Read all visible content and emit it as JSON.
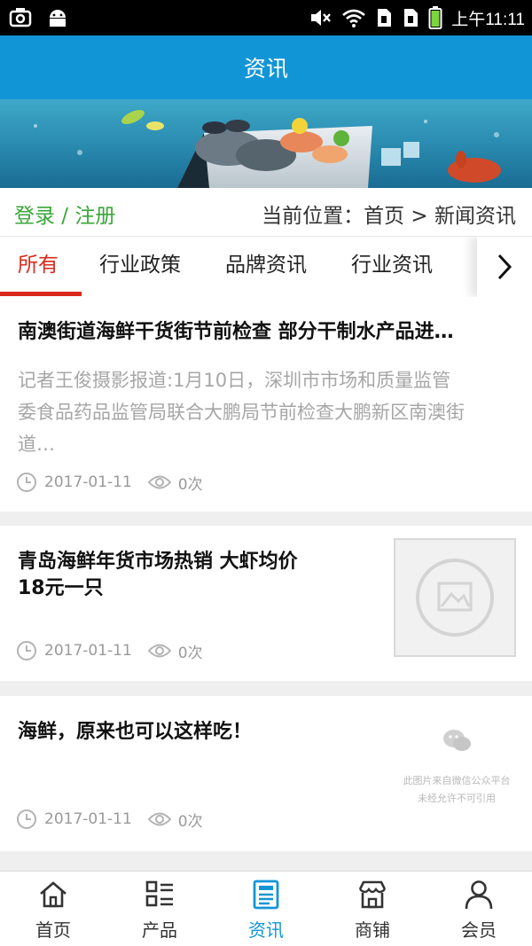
{
  "status_bar": {
    "time": "上午11:11"
  },
  "header": {
    "title": "资讯"
  },
  "location": {
    "login_link": "登录 / 注册",
    "breadcrumb": "当前位置：首页 > 新闻资讯"
  },
  "tabs": [
    {
      "label": "所有",
      "active": true
    },
    {
      "label": "行业政策",
      "active": false
    },
    {
      "label": "品牌资讯",
      "active": false
    },
    {
      "label": "行业资讯",
      "active": false
    }
  ],
  "articles": [
    {
      "title": "南澳街道海鲜干货街节前检查 部分干制水产品进…",
      "summary_line1": "记者王俊摄影报道:1月10日，深圳市市场和质量监管",
      "summary_line2": "委食品药品监管局联合大鹏局节前检查大鹏新区南澳街",
      "summary_line3": "道…",
      "date": "2017-01-11",
      "views": "0次"
    },
    {
      "title_line1": "青岛海鲜年货市场热销 大虾均价",
      "title_line2": "18元一只",
      "date": "2017-01-11",
      "views": "0次"
    },
    {
      "title": "海鲜，原来也可以这样吃！",
      "watermark_line1": "此图片来自微信公众平台",
      "watermark_line2": "未经允许不可引用",
      "date": "2017-01-11",
      "views": "0次"
    }
  ],
  "bottom_nav": [
    {
      "label": "首页",
      "icon": "home-icon",
      "active": false
    },
    {
      "label": "产品",
      "icon": "product-list-icon",
      "active": false
    },
    {
      "label": "资讯",
      "icon": "news-icon",
      "active": true
    },
    {
      "label": "商铺",
      "icon": "shop-icon",
      "active": false
    },
    {
      "label": "会员",
      "icon": "member-icon",
      "active": false
    }
  ],
  "colors": {
    "primary": "#1295d6",
    "active_tab": "#d9291c",
    "login_green": "#3aa63a",
    "muted": "#a6a6a6"
  }
}
